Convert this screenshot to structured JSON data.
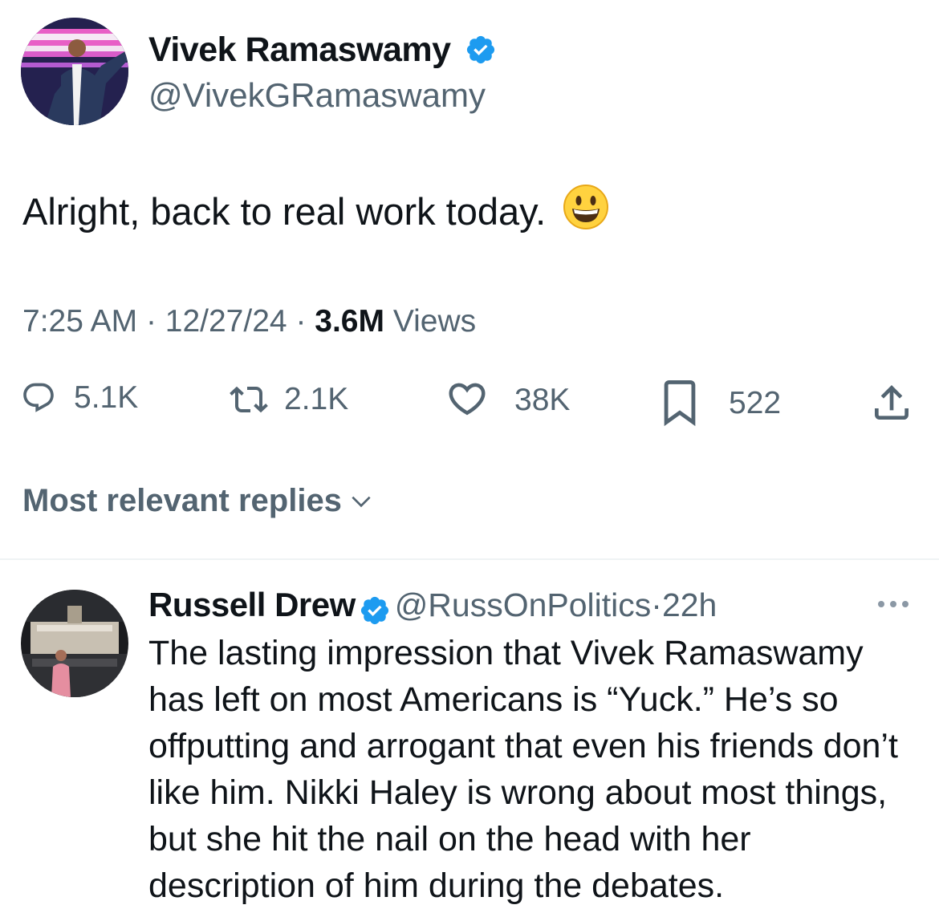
{
  "tweet": {
    "author_name": "Vivek Ramaswamy",
    "author_handle": "@VivekGRamaswamy",
    "text": "Alright, back to real work today.",
    "emoji": "😀",
    "time": "7:25 AM",
    "date": "12/27/24",
    "views_count": "3.6M",
    "views_label": "Views",
    "separator": "·"
  },
  "actions": {
    "replies": "5.1K",
    "reposts": "2.1K",
    "likes": "38K",
    "bookmarks": "522"
  },
  "icons": [
    "verified-badge-icon",
    "reply-icon",
    "repost-icon",
    "like-icon",
    "bookmark-icon",
    "share-icon",
    "chevron-down-icon",
    "more-icon"
  ],
  "sort": {
    "label": "Most relevant replies"
  },
  "reply": {
    "author_name": "Russell Drew",
    "author_handle": "@RussOnPolitics",
    "separator": "·",
    "age": "22h",
    "text": "The lasting impression that Vivek Ramaswamy has left on most Americans is “Yuck.” He’s so offputting and arrogant that even his friends don’t like him. Nikki Haley is wrong about most things, but she hit the nail on the head with her description of him during the debates."
  },
  "colors": {
    "verified": "#1d9bf0",
    "secondary_text": "#536471",
    "primary_text": "#0f1419"
  }
}
